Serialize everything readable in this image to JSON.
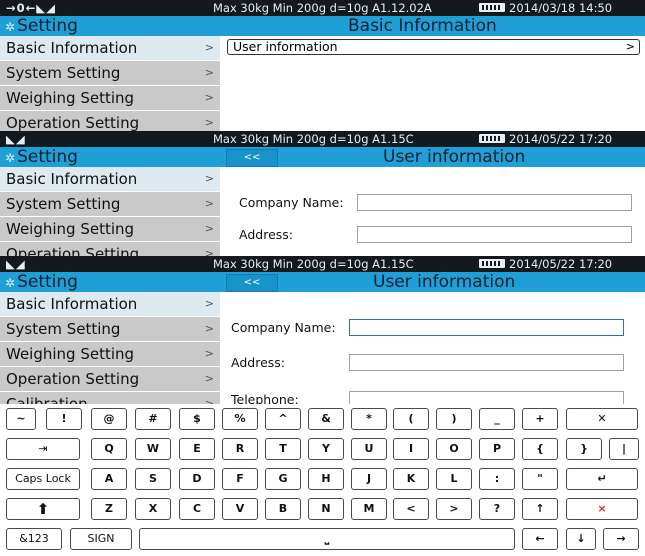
{
  "panel1": {
    "status": {
      "symbols": "→0←◣◢",
      "info": "Max 30kg  Min 200g  d=10g   A1.12.02A",
      "datetime": "2014/03/18  14:50"
    },
    "title_left": "Setting",
    "title_right": "Basic Information",
    "sidebar": [
      "Basic Information",
      "System Setting",
      "Weighing Setting",
      "Operation Setting"
    ],
    "list_item": "User information"
  },
  "panel2": {
    "status": {
      "symbols": "◣◢",
      "info": "Max 30kg  Min 200g  d=10g   A1.15C",
      "datetime": "2014/05/22  17:20"
    },
    "title_left": "Setting",
    "back": "<<",
    "title_right": "User information",
    "sidebar": [
      "Basic Information",
      "System Setting",
      "Weighing Setting",
      "Operation Setting"
    ],
    "labels": {
      "company": "Company Name:",
      "address": "Address:"
    },
    "values": {
      "company": "",
      "address": ""
    }
  },
  "panel3": {
    "status": {
      "symbols": "◣◢",
      "info": "Max 30kg  Min 200g  d=10g   A1.15C",
      "datetime": "2014/05/22  17:20"
    },
    "title_left": "Setting",
    "back": "<<",
    "title_right": "User information",
    "sidebar": [
      "Basic Information",
      "System Setting",
      "Weighing Setting",
      "Operation Setting",
      "Calibration"
    ],
    "labels": {
      "company": "Company Name:",
      "address": "Address:",
      "telephone": "Telephone:"
    },
    "values": {
      "company": "",
      "address": "",
      "telephone": ""
    }
  },
  "keyboard": {
    "row1": [
      "~",
      "!",
      "@",
      "#",
      "$",
      "%",
      "^",
      "&",
      "*",
      "(",
      ")",
      "_",
      "+",
      "✕"
    ],
    "row2": [
      "⇥",
      "Q",
      "W",
      "E",
      "R",
      "T",
      "Y",
      "U",
      "I",
      "O",
      "P",
      "{",
      "}",
      "|"
    ],
    "row3": [
      "Caps Lock",
      "A",
      "S",
      "D",
      "F",
      "G",
      "H",
      "J",
      "K",
      "L",
      ":",
      "\"",
      "↵"
    ],
    "row4": [
      "⬆",
      "Z",
      "X",
      "C",
      "V",
      "B",
      "N",
      "M",
      "<",
      ">",
      "?",
      "↑",
      "×"
    ],
    "row5": [
      "&123",
      "SIGN",
      "⎵",
      "←",
      "↓",
      "→"
    ]
  },
  "colors": {
    "accent": "#1f9fd6",
    "statusbar": "#121a20",
    "sidebar": "#c9c9c9",
    "sidebar_active": "#dfe9f0"
  }
}
